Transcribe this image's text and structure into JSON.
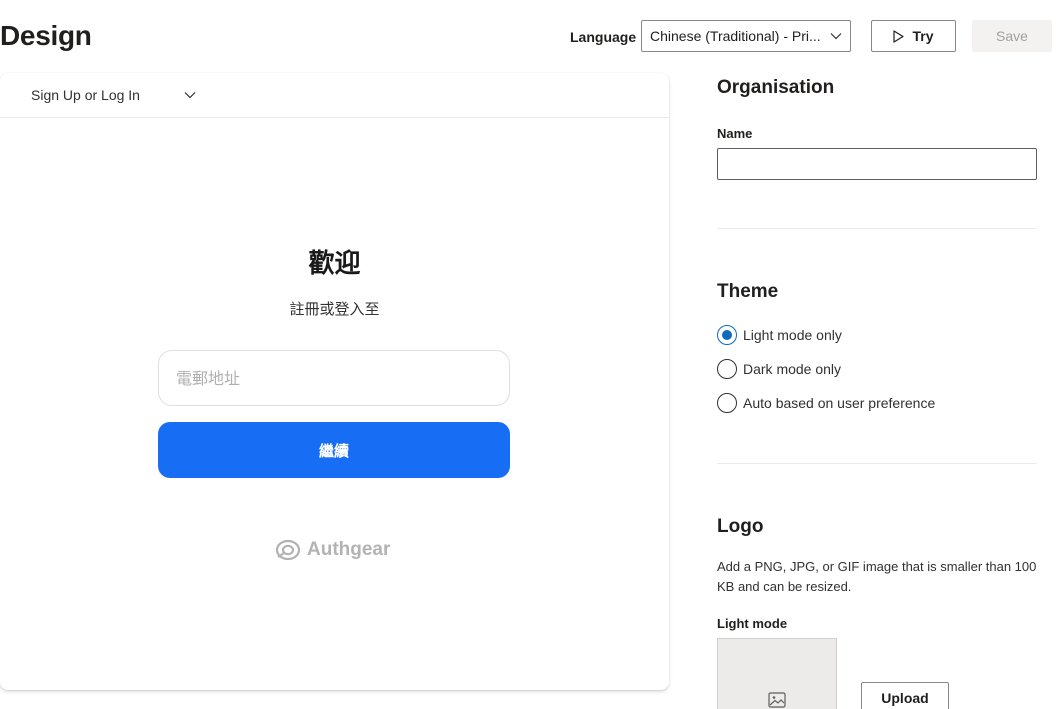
{
  "header": {
    "title": "Design",
    "language_label": "Language",
    "language_value": "Chinese (Traditional) - Pri...",
    "try_label": "Try",
    "save_label": "Save"
  },
  "preview": {
    "page_selector": "Sign Up or Log In",
    "welcome_title": "歡迎",
    "welcome_subtitle": "註冊或登入至",
    "email_placeholder": "電郵地址",
    "continue_label": "繼續",
    "brand_name": "Authgear",
    "accent_color": "#176df3"
  },
  "organisation": {
    "section_title": "Organisation",
    "name_label": "Name",
    "name_value": ""
  },
  "theme": {
    "section_title": "Theme",
    "options": [
      {
        "label": "Light mode only",
        "checked": true
      },
      {
        "label": "Dark mode only",
        "checked": false
      },
      {
        "label": "Auto based on user preference",
        "checked": false
      }
    ]
  },
  "logo": {
    "section_title": "Logo",
    "description": "Add a PNG, JPG, or GIF image that is smaller than 100 KB and can be resized.",
    "light_mode_label": "Light mode",
    "upload_label": "Upload",
    "placeholder_icon": "image-icon"
  }
}
